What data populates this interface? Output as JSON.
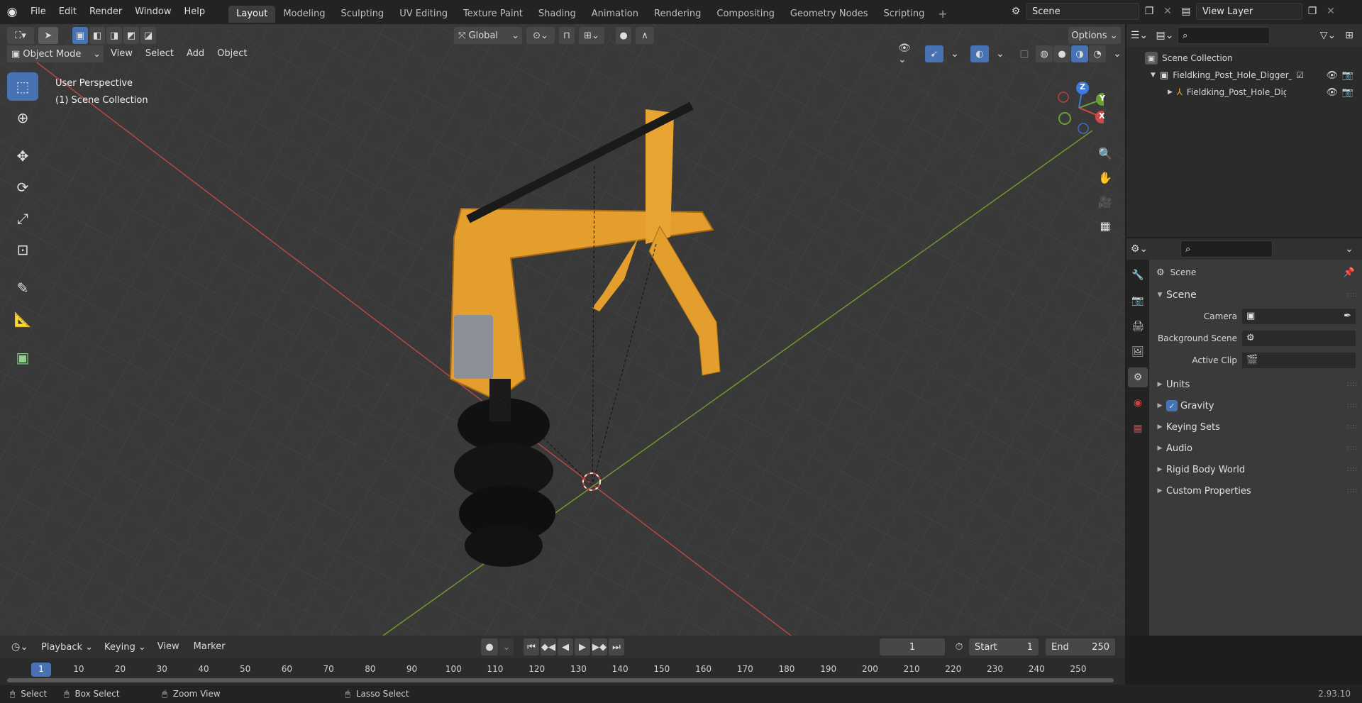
{
  "topbar": {
    "menus": [
      "File",
      "Edit",
      "Render",
      "Window",
      "Help"
    ],
    "workspaces": [
      "Layout",
      "Modeling",
      "Sculpting",
      "UV Editing",
      "Texture Paint",
      "Shading",
      "Animation",
      "Rendering",
      "Compositing",
      "Geometry Nodes",
      "Scripting"
    ],
    "active_workspace": "Layout",
    "scene_name": "Scene",
    "view_layer": "View Layer"
  },
  "viewport": {
    "transform_orientation": "Global",
    "options_label": "Options",
    "mode": "Object Mode",
    "header_menus": [
      "View",
      "Select",
      "Add",
      "Object"
    ],
    "overlay_title": "User Perspective",
    "overlay_subtitle": "(1) Scene Collection",
    "gizmo_axes": {
      "x": "X",
      "y": "Y",
      "z": "Z"
    }
  },
  "outliner": {
    "root": "Scene Collection",
    "items": [
      {
        "label": "Fieldking_Post_Hole_Digger_C",
        "type": "collection"
      },
      {
        "label": "Fieldking_Post_Hole_Digg",
        "type": "object"
      }
    ]
  },
  "properties": {
    "context_title": "Scene",
    "panel_title": "Scene",
    "fields": [
      {
        "label": "Camera",
        "value": ""
      },
      {
        "label": "Background Scene",
        "value": ""
      },
      {
        "label": "Active Clip",
        "value": ""
      }
    ],
    "panels": [
      {
        "label": "Units",
        "checkbox": false
      },
      {
        "label": "Gravity",
        "checkbox": true
      },
      {
        "label": "Keying Sets",
        "checkbox": false
      },
      {
        "label": "Audio",
        "checkbox": false
      },
      {
        "label": "Rigid Body World",
        "checkbox": false
      },
      {
        "label": "Custom Properties",
        "checkbox": false
      }
    ]
  },
  "timeline": {
    "menus": [
      "Playback",
      "Keying",
      "View",
      "Marker"
    ],
    "current_frame": "1",
    "start_label": "Start",
    "start_value": "1",
    "end_label": "End",
    "end_value": "250",
    "ticks": [
      "1",
      "10",
      "20",
      "30",
      "40",
      "50",
      "60",
      "70",
      "80",
      "90",
      "100",
      "110",
      "120",
      "130",
      "140",
      "150",
      "160",
      "170",
      "180",
      "190",
      "200",
      "210",
      "220",
      "230",
      "240",
      "250"
    ]
  },
  "statusbar": {
    "select": "Select",
    "box_select": "Box Select",
    "zoom_view": "Zoom View",
    "lasso_select": "Lasso Select",
    "version": "2.93.10"
  },
  "colors": {
    "accent": "#4772b3",
    "model_orange": "#e8a030",
    "x_axis": "#c84646",
    "y_axis": "#78a032"
  }
}
